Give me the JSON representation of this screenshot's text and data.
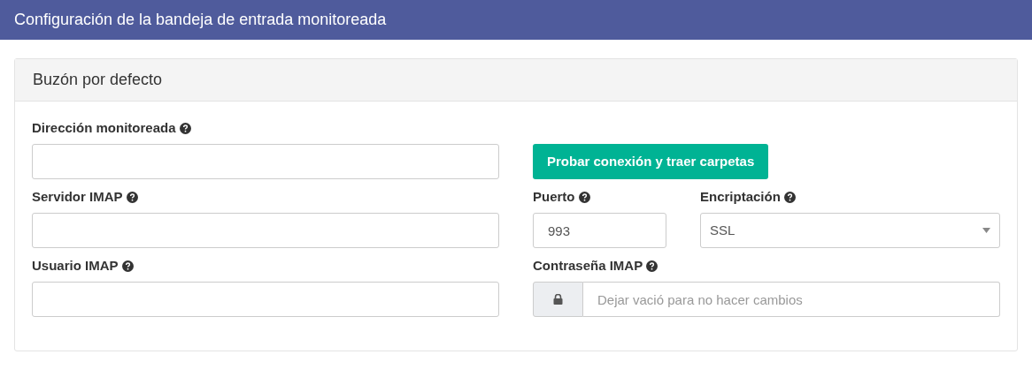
{
  "page_title": "Configuración de la bandeja de entrada monitoreada",
  "panel": {
    "title": "Buzón por defecto",
    "rows": [
      {
        "items": [
          {
            "kind": "text",
            "label": "Dirección monitoreada",
            "help": true
          },
          {
            "kind": "button",
            "label": "Probar conexión y traer carpetas"
          }
        ]
      },
      {
        "items": [
          {
            "kind": "text",
            "label": "Servidor IMAP",
            "help": true
          },
          {
            "kind": "short-text",
            "label": "Puerto",
            "help": true,
            "value": "993"
          },
          {
            "kind": "select",
            "label": "Encriptación",
            "help": true,
            "value": "SSL"
          }
        ]
      },
      {
        "items": [
          {
            "kind": "text",
            "label": "Usuario IMAP",
            "help": true
          },
          {
            "kind": "password",
            "label": "Contraseña IMAP",
            "help": true,
            "placeholder": "Dejar vació para no hacer cambios"
          }
        ]
      }
    ]
  }
}
